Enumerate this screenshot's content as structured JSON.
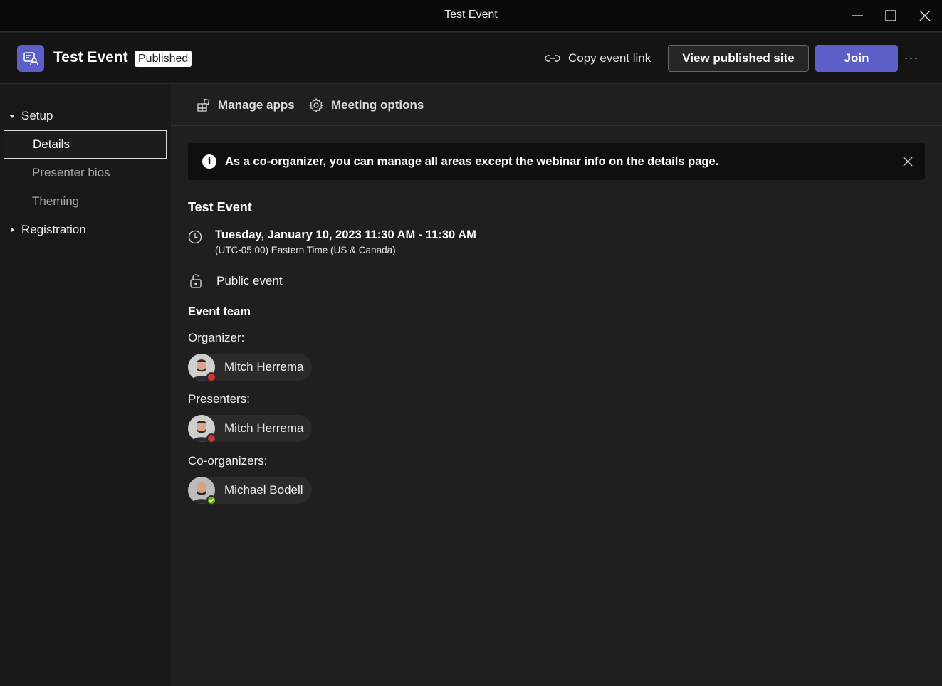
{
  "window": {
    "title": "Test Event"
  },
  "header": {
    "event_title": "Test Event",
    "status": "Published",
    "copy_link": "Copy event link",
    "view_site": "View published site",
    "join": "Join",
    "more": "···"
  },
  "sidebar": {
    "groups": [
      {
        "label": "Setup",
        "expanded": true
      },
      {
        "label": "Registration",
        "expanded": false
      }
    ],
    "items": [
      {
        "label": "Details",
        "active": true
      },
      {
        "label": "Presenter bios",
        "active": false
      },
      {
        "label": "Theming",
        "active": false
      }
    ]
  },
  "toolbar": {
    "manage_apps": "Manage apps",
    "meeting_options": "Meeting options"
  },
  "notice": {
    "icon_text": "i",
    "message": "As a co-organizer, you can manage all areas except the webinar info on the details page."
  },
  "details": {
    "title": "Test Event",
    "date": "Tuesday, January 10, 2023 11:30 AM - 11:30 AM",
    "timezone": "(UTC-05:00) Eastern Time (US & Canada)",
    "privacy": "Public event",
    "team_heading": "Event team",
    "organizer_label": "Organizer:",
    "organizer": {
      "name": "Mitch Herrema",
      "presence": "busy"
    },
    "presenters_label": "Presenters:",
    "presenter": {
      "name": "Mitch Herrema",
      "presence": "busy"
    },
    "coorganizers_label": "Co-organizers:",
    "coorganizer": {
      "name": "Michael Bodell",
      "presence": "available"
    }
  },
  "colors": {
    "accent": "#5b5fc7",
    "busy": "#d13438",
    "available": "#6bb700"
  }
}
